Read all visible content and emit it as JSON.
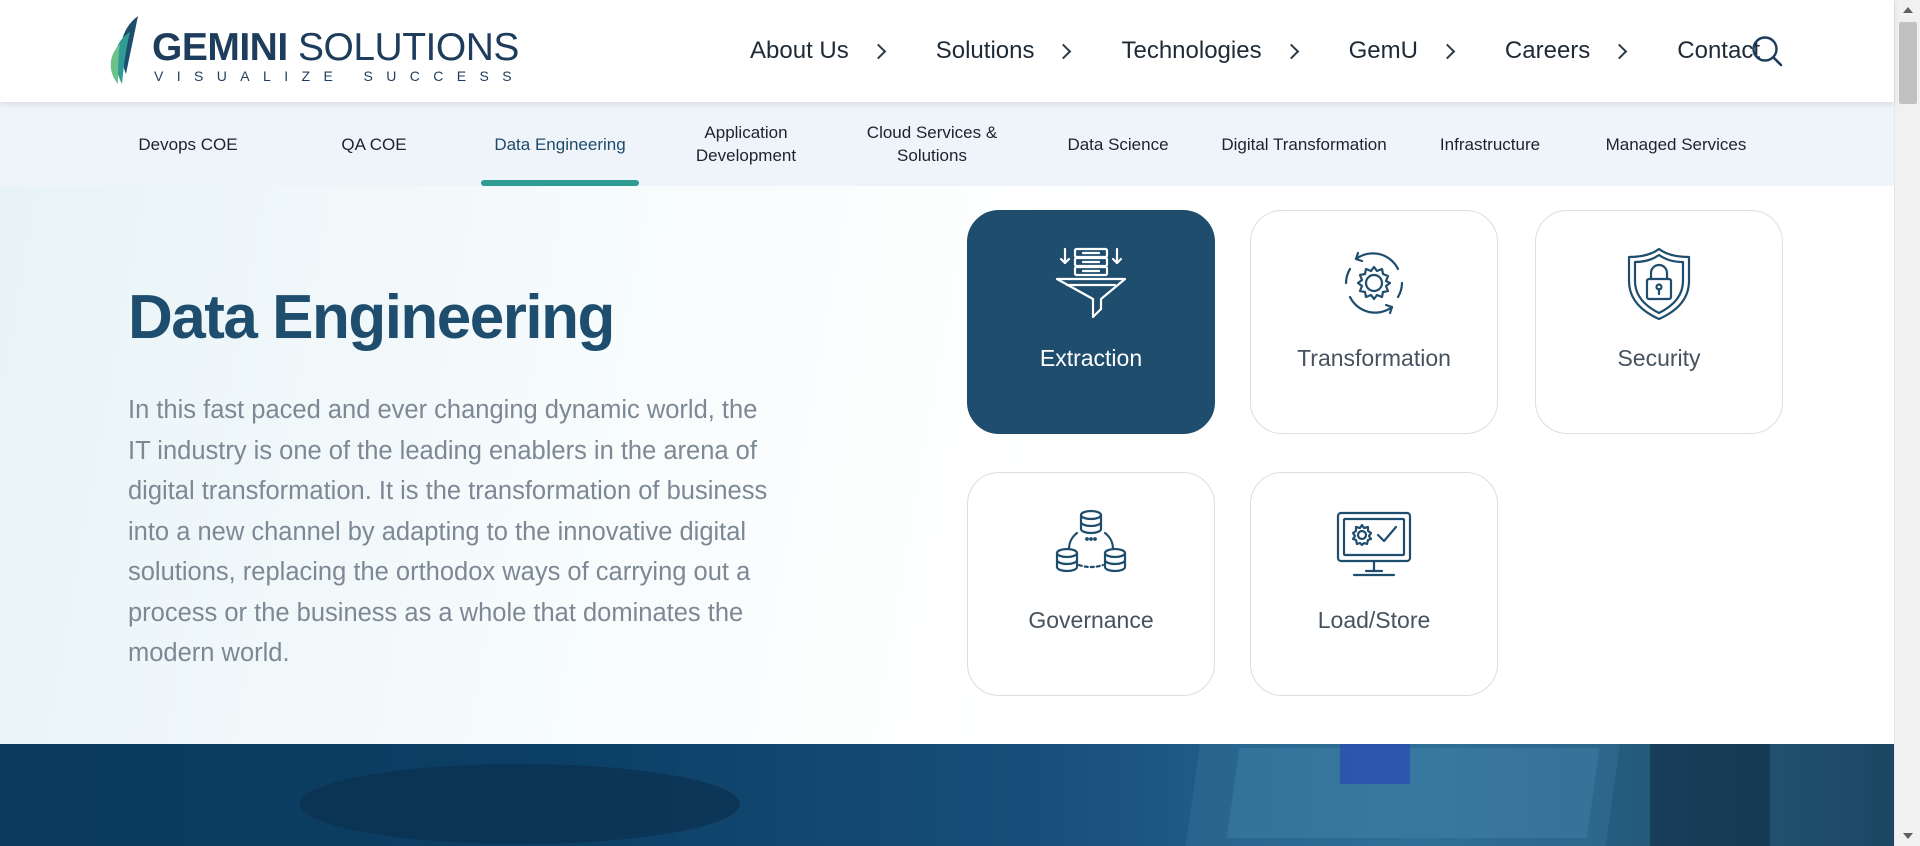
{
  "brand": {
    "name_bold": "GEMINI",
    "name_light": " SOLUTIONS",
    "tagline": "VISUALIZE SUCCESS",
    "color": "#1e3d5c",
    "leaf_colors": [
      "#2e9c94",
      "#6cc08a"
    ]
  },
  "main_nav": [
    {
      "label": "About Us",
      "has_chevron": true
    },
    {
      "label": "Solutions",
      "has_chevron": true
    },
    {
      "label": "Technologies",
      "has_chevron": true
    },
    {
      "label": "GemU",
      "has_chevron": true
    },
    {
      "label": "Careers",
      "has_chevron": true
    },
    {
      "label": "Contact",
      "has_chevron": false
    }
  ],
  "search": {
    "icon": "search-icon"
  },
  "sub_nav": [
    {
      "label": "Devops COE",
      "active": false
    },
    {
      "label": "QA COE",
      "active": false
    },
    {
      "label": "Data Engineering",
      "active": true
    },
    {
      "label": "Application Development",
      "active": false
    },
    {
      "label": "Cloud Services & Solutions",
      "active": false
    },
    {
      "label": "Data Science",
      "active": false
    },
    {
      "label": "Digital Transformation",
      "active": false
    },
    {
      "label": "Infrastructure",
      "active": false
    },
    {
      "label": "Managed Services",
      "active": false
    }
  ],
  "hero": {
    "title": "Data Engineering",
    "description": "In this fast paced and ever changing dynamic world, the IT industry is one of the leading enablers in the arena of digital transformation. It is the transformation of business into a new channel by adapting to the innovative digital solutions, replacing the orthodox ways of carrying out a process or the business as a whole that dominates the modern world."
  },
  "cards": [
    {
      "label": "Extraction",
      "icon": "funnel-extraction-icon",
      "active": true
    },
    {
      "label": "Transformation",
      "icon": "gear-cycle-icon",
      "active": false
    },
    {
      "label": "Security",
      "icon": "shield-lock-icon",
      "active": false
    },
    {
      "label": "Governance",
      "icon": "database-network-icon",
      "active": false
    },
    {
      "label": "Load/Store",
      "icon": "monitor-gear-check-icon",
      "active": false
    }
  ],
  "colors": {
    "accent_teal": "#2e9c94",
    "navy": "#1e4d6d",
    "subnav_bg": "#eef4f9",
    "body_text": "#7c8894"
  }
}
